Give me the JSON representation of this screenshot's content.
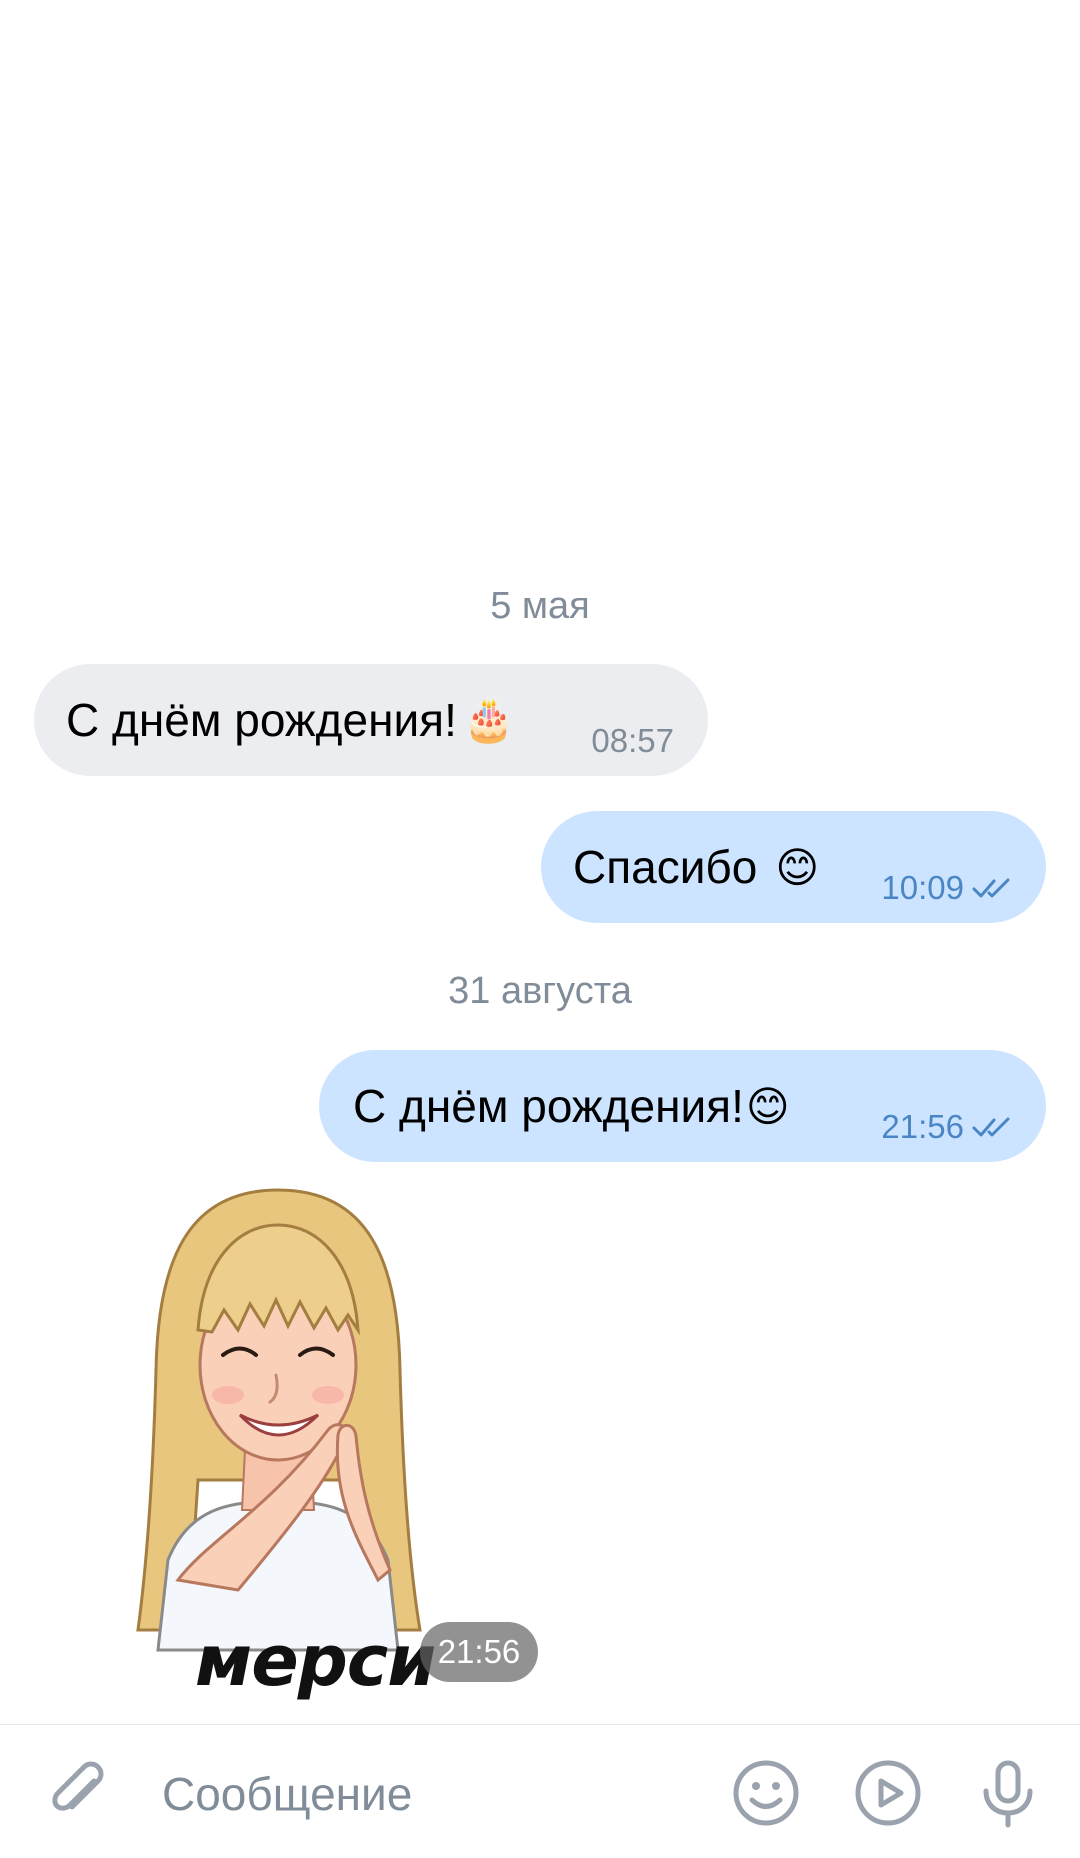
{
  "chat": {
    "groups": [
      {
        "date": "5 мая",
        "messages": [
          {
            "direction": "in",
            "text": "С днём рождения!",
            "emoji": "🎂",
            "time": "08:57"
          },
          {
            "direction": "out",
            "text": "Спасибо",
            "emoji": "😊",
            "time": "10:09",
            "read": true
          }
        ]
      },
      {
        "date": "31 августа",
        "messages": [
          {
            "direction": "out",
            "text": "С днём рождения!",
            "emoji": "😊",
            "time": "21:56",
            "read": true
          }
        ]
      }
    ],
    "sticker": {
      "caption": "мерси",
      "time": "21:56"
    }
  },
  "composer": {
    "placeholder": "Сообщение",
    "value": "",
    "icons": [
      "paperclip-icon",
      "smile-icon",
      "play-icon",
      "microphone-icon"
    ]
  },
  "colors": {
    "incoming_bubble": "#ebedf0",
    "outgoing_bubble": "#cce4ff",
    "secondary_text": "#818c99",
    "outgoing_time": "#4a86c5",
    "icon": "#99a2ad"
  }
}
